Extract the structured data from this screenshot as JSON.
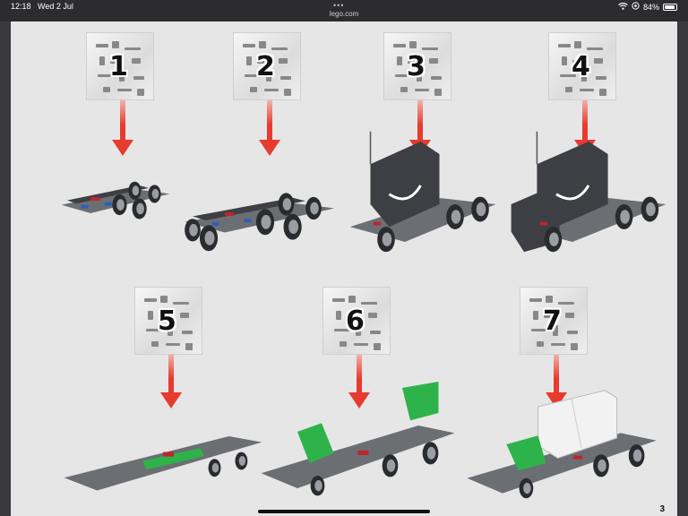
{
  "status": {
    "time": "12:18",
    "date": "Wed 2 Jul",
    "url": "lego.com",
    "battery": "84%"
  },
  "page_number": "3",
  "steps": [
    {
      "number": "1"
    },
    {
      "number": "2"
    },
    {
      "number": "3"
    },
    {
      "number": "4"
    },
    {
      "number": "5"
    },
    {
      "number": "6"
    },
    {
      "number": "7"
    }
  ],
  "colors": {
    "arrow": "#e63b2e",
    "model_dark": "#3d3f44",
    "model_mid": "#6b6e73",
    "accent_red": "#c0242b",
    "accent_green": "#2eb34a",
    "accent_blue": "#2f5fb3",
    "container": "#f2f2f2"
  }
}
